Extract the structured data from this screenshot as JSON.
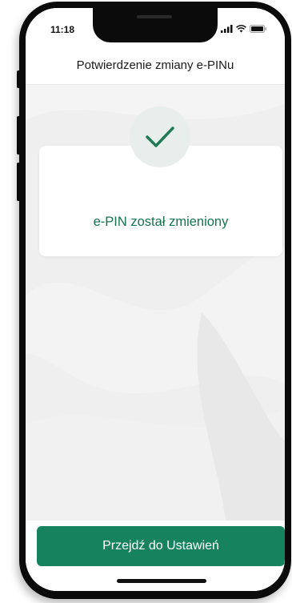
{
  "status_bar": {
    "time": "11:18",
    "icons": [
      "signal-icon",
      "wifi-icon",
      "battery-icon"
    ]
  },
  "header": {
    "title": "Potwierdzenie zmiany e-PINu"
  },
  "confirmation": {
    "icon": "checkmark-icon",
    "message": "e-PIN został zmieniony"
  },
  "actions": {
    "primary_label": "Przejdź do Ustawień"
  },
  "colors": {
    "brand_green": "#16835e",
    "message_green": "#16734f",
    "check_green": "#1f7a55",
    "background": "#efefef"
  }
}
